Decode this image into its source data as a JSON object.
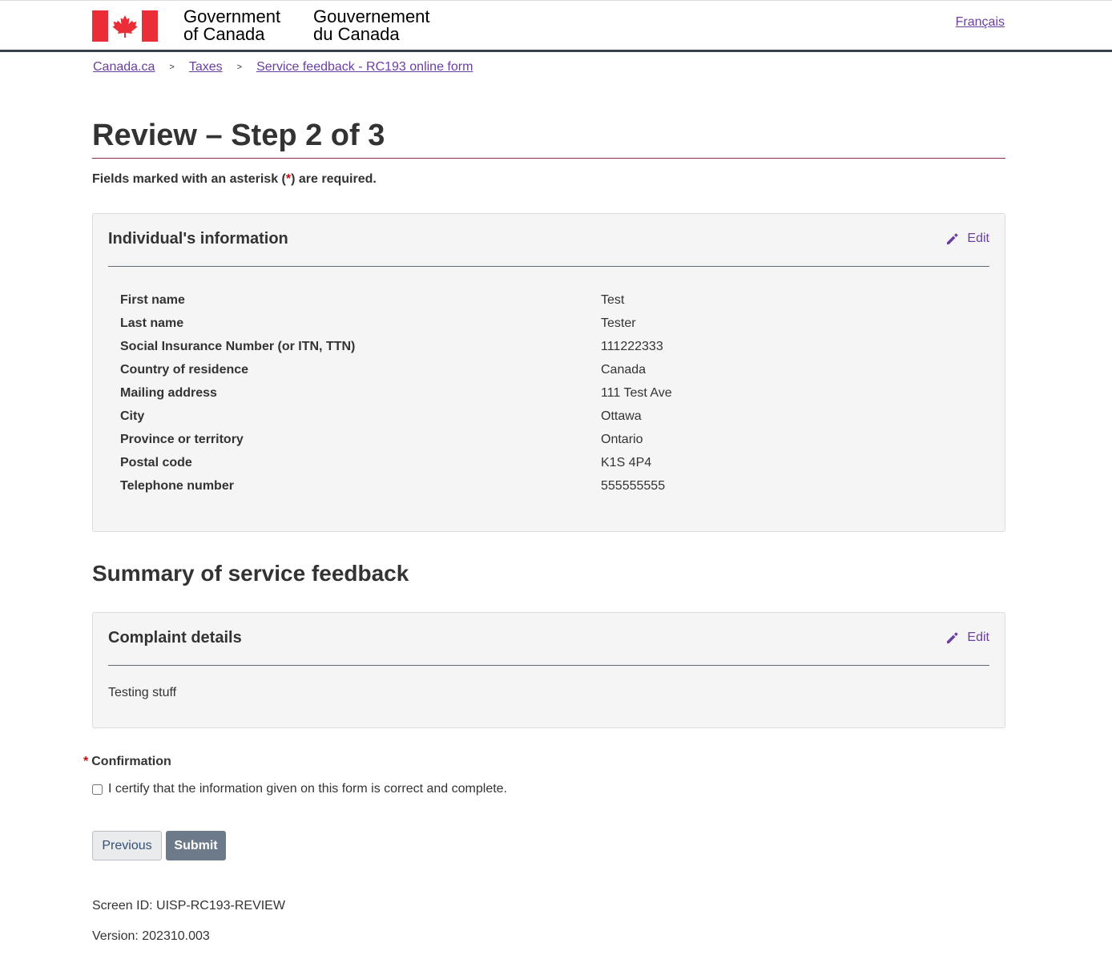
{
  "header": {
    "signature_en_line1": "Government",
    "signature_en_line2": "of Canada",
    "signature_fr_line1": "Gouvernement",
    "signature_fr_line2": "du Canada",
    "language_toggle": "Français",
    "flag_icon": "canada-flag-icon"
  },
  "breadcrumb": {
    "items": [
      {
        "label": "Canada.ca"
      },
      {
        "label": "Taxes"
      },
      {
        "label": "Service feedback - RC193 online form"
      }
    ],
    "separator": ">"
  },
  "page": {
    "title": "Review – Step 2 of 3",
    "required_prefix": "Fields marked with an asterisk (",
    "required_asterisk": "*",
    "required_suffix": ") are required."
  },
  "individual": {
    "heading": "Individual's information",
    "edit_label": "Edit",
    "fields": [
      {
        "label": "First name",
        "value": "Test"
      },
      {
        "label": "Last name",
        "value": "Tester"
      },
      {
        "label": "Social Insurance Number (or ITN, TTN)",
        "value": "111222333"
      },
      {
        "label": "Country of residence",
        "value": "Canada"
      },
      {
        "label": "Mailing address",
        "value": "111 Test Ave"
      },
      {
        "label": "City",
        "value": "Ottawa"
      },
      {
        "label": "Province or territory",
        "value": "Ontario"
      },
      {
        "label": "Postal code",
        "value": "K1S 4P4"
      },
      {
        "label": "Telephone number",
        "value": "555555555"
      }
    ]
  },
  "summary": {
    "title": "Summary of service feedback",
    "complaint_heading": "Complaint details",
    "edit_label": "Edit",
    "complaint_text": "Testing stuff"
  },
  "confirmation": {
    "asterisk": "*",
    "label": "Confirmation",
    "checkbox_text": "I certify that the information given on this form is correct and complete.",
    "checked": false
  },
  "buttons": {
    "previous": "Previous",
    "submit": "Submit"
  },
  "meta": {
    "screen_id": "Screen ID: UISP-RC193-REVIEW",
    "version": "Version: 202310.003"
  },
  "colors": {
    "link": "#6b3fa0",
    "flag_red": "#eb2d37",
    "header_rule": "#38414d",
    "title_rule": "#8a2a4f",
    "required": "#d3080c",
    "submit_bg": "#6d7a89"
  }
}
